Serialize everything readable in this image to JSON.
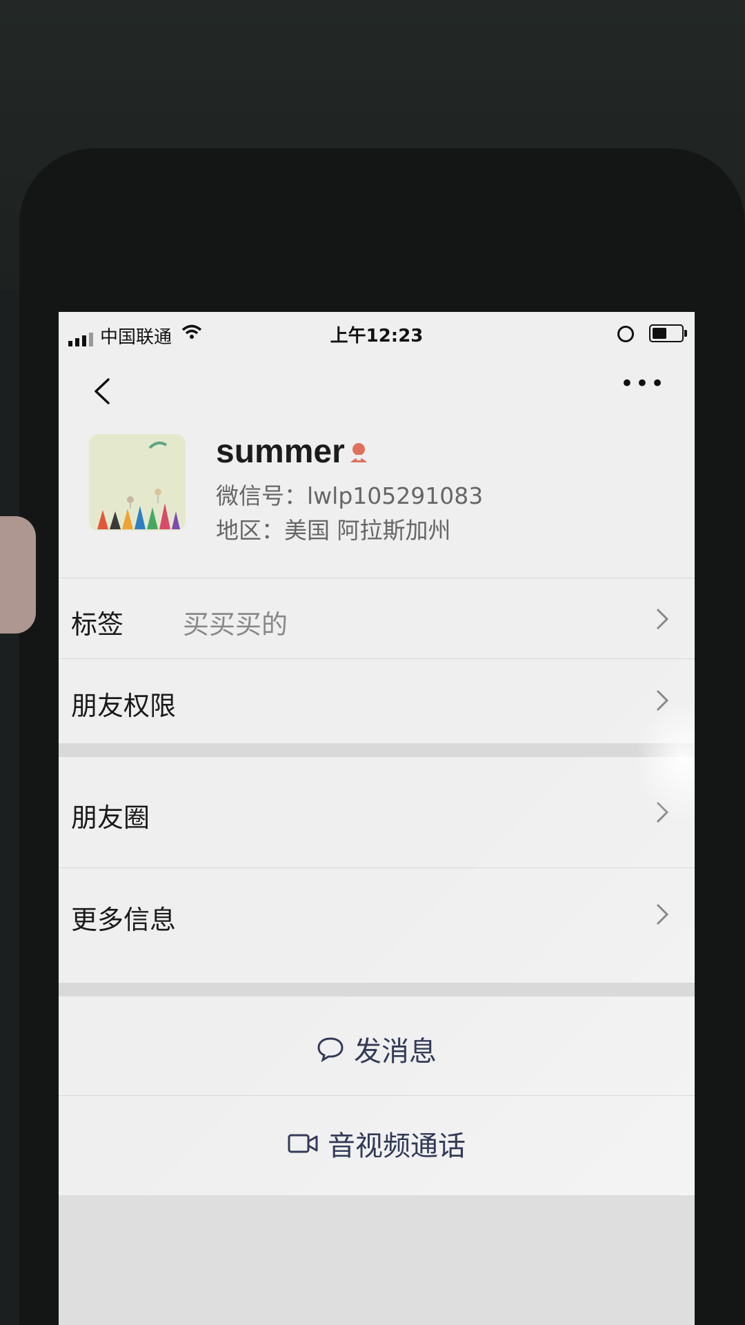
{
  "status_bar": {
    "carrier": "中国联通",
    "time": "上午12:23"
  },
  "nav": {
    "more_label": "•••"
  },
  "profile": {
    "name": "summer",
    "wechat_id": "微信号：lwlp105291083",
    "region": "地区：美国 阿拉斯加州"
  },
  "rows": {
    "tags": {
      "label": "标签",
      "value": "买买买的"
    },
    "friend_permissions": {
      "label": "朋友权限"
    },
    "moments": {
      "label": "朋友圈"
    },
    "more_info": {
      "label": "更多信息"
    }
  },
  "actions": {
    "send_message": "发消息",
    "video_call": "音视频通话"
  },
  "colors": {
    "screen_bg": "#efefef",
    "action_text": "#333a58",
    "gender_icon": "#e0705c"
  },
  "icons": {
    "signal": "signal-icon",
    "wifi": "wifi-icon",
    "rotation_lock": "rotation-lock-icon",
    "battery": "battery-icon",
    "back": "back-chevron-icon",
    "gender": "female-gender-icon",
    "chevron": "chevron-right-icon",
    "message": "speech-bubble-icon",
    "video": "video-camera-icon"
  }
}
